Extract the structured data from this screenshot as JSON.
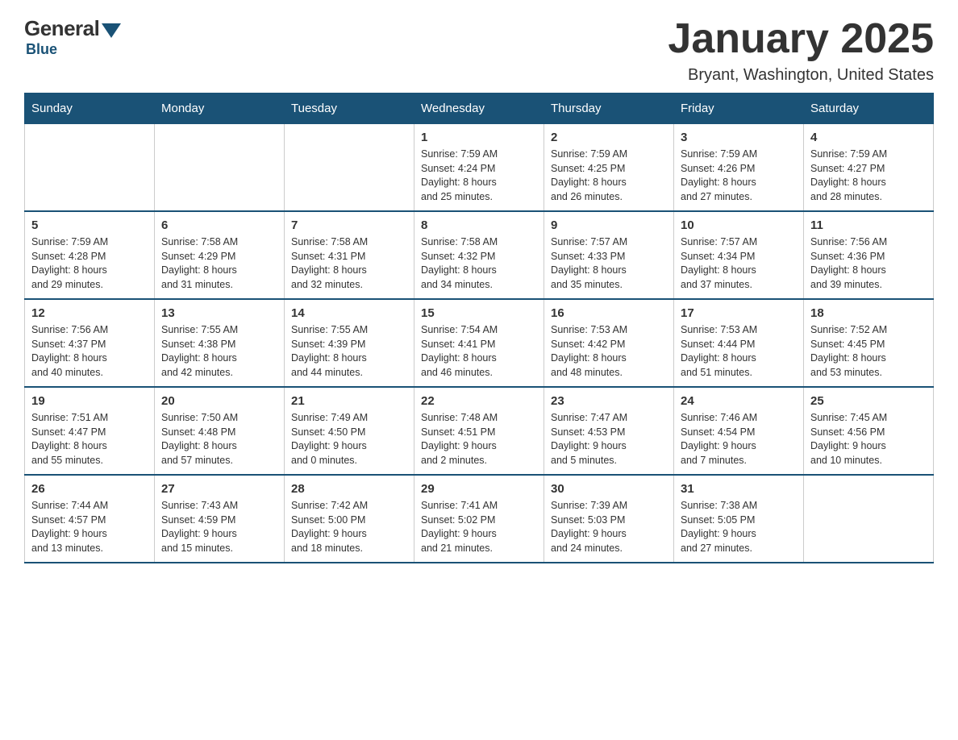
{
  "logo": {
    "general": "General",
    "blue": "Blue",
    "bottom": "Blue"
  },
  "title": "January 2025",
  "subtitle": "Bryant, Washington, United States",
  "days_of_week": [
    "Sunday",
    "Monday",
    "Tuesday",
    "Wednesday",
    "Thursday",
    "Friday",
    "Saturday"
  ],
  "weeks": [
    [
      {
        "day": "",
        "info": ""
      },
      {
        "day": "",
        "info": ""
      },
      {
        "day": "",
        "info": ""
      },
      {
        "day": "1",
        "info": "Sunrise: 7:59 AM\nSunset: 4:24 PM\nDaylight: 8 hours\nand 25 minutes."
      },
      {
        "day": "2",
        "info": "Sunrise: 7:59 AM\nSunset: 4:25 PM\nDaylight: 8 hours\nand 26 minutes."
      },
      {
        "day": "3",
        "info": "Sunrise: 7:59 AM\nSunset: 4:26 PM\nDaylight: 8 hours\nand 27 minutes."
      },
      {
        "day": "4",
        "info": "Sunrise: 7:59 AM\nSunset: 4:27 PM\nDaylight: 8 hours\nand 28 minutes."
      }
    ],
    [
      {
        "day": "5",
        "info": "Sunrise: 7:59 AM\nSunset: 4:28 PM\nDaylight: 8 hours\nand 29 minutes."
      },
      {
        "day": "6",
        "info": "Sunrise: 7:58 AM\nSunset: 4:29 PM\nDaylight: 8 hours\nand 31 minutes."
      },
      {
        "day": "7",
        "info": "Sunrise: 7:58 AM\nSunset: 4:31 PM\nDaylight: 8 hours\nand 32 minutes."
      },
      {
        "day": "8",
        "info": "Sunrise: 7:58 AM\nSunset: 4:32 PM\nDaylight: 8 hours\nand 34 minutes."
      },
      {
        "day": "9",
        "info": "Sunrise: 7:57 AM\nSunset: 4:33 PM\nDaylight: 8 hours\nand 35 minutes."
      },
      {
        "day": "10",
        "info": "Sunrise: 7:57 AM\nSunset: 4:34 PM\nDaylight: 8 hours\nand 37 minutes."
      },
      {
        "day": "11",
        "info": "Sunrise: 7:56 AM\nSunset: 4:36 PM\nDaylight: 8 hours\nand 39 minutes."
      }
    ],
    [
      {
        "day": "12",
        "info": "Sunrise: 7:56 AM\nSunset: 4:37 PM\nDaylight: 8 hours\nand 40 minutes."
      },
      {
        "day": "13",
        "info": "Sunrise: 7:55 AM\nSunset: 4:38 PM\nDaylight: 8 hours\nand 42 minutes."
      },
      {
        "day": "14",
        "info": "Sunrise: 7:55 AM\nSunset: 4:39 PM\nDaylight: 8 hours\nand 44 minutes."
      },
      {
        "day": "15",
        "info": "Sunrise: 7:54 AM\nSunset: 4:41 PM\nDaylight: 8 hours\nand 46 minutes."
      },
      {
        "day": "16",
        "info": "Sunrise: 7:53 AM\nSunset: 4:42 PM\nDaylight: 8 hours\nand 48 minutes."
      },
      {
        "day": "17",
        "info": "Sunrise: 7:53 AM\nSunset: 4:44 PM\nDaylight: 8 hours\nand 51 minutes."
      },
      {
        "day": "18",
        "info": "Sunrise: 7:52 AM\nSunset: 4:45 PM\nDaylight: 8 hours\nand 53 minutes."
      }
    ],
    [
      {
        "day": "19",
        "info": "Sunrise: 7:51 AM\nSunset: 4:47 PM\nDaylight: 8 hours\nand 55 minutes."
      },
      {
        "day": "20",
        "info": "Sunrise: 7:50 AM\nSunset: 4:48 PM\nDaylight: 8 hours\nand 57 minutes."
      },
      {
        "day": "21",
        "info": "Sunrise: 7:49 AM\nSunset: 4:50 PM\nDaylight: 9 hours\nand 0 minutes."
      },
      {
        "day": "22",
        "info": "Sunrise: 7:48 AM\nSunset: 4:51 PM\nDaylight: 9 hours\nand 2 minutes."
      },
      {
        "day": "23",
        "info": "Sunrise: 7:47 AM\nSunset: 4:53 PM\nDaylight: 9 hours\nand 5 minutes."
      },
      {
        "day": "24",
        "info": "Sunrise: 7:46 AM\nSunset: 4:54 PM\nDaylight: 9 hours\nand 7 minutes."
      },
      {
        "day": "25",
        "info": "Sunrise: 7:45 AM\nSunset: 4:56 PM\nDaylight: 9 hours\nand 10 minutes."
      }
    ],
    [
      {
        "day": "26",
        "info": "Sunrise: 7:44 AM\nSunset: 4:57 PM\nDaylight: 9 hours\nand 13 minutes."
      },
      {
        "day": "27",
        "info": "Sunrise: 7:43 AM\nSunset: 4:59 PM\nDaylight: 9 hours\nand 15 minutes."
      },
      {
        "day": "28",
        "info": "Sunrise: 7:42 AM\nSunset: 5:00 PM\nDaylight: 9 hours\nand 18 minutes."
      },
      {
        "day": "29",
        "info": "Sunrise: 7:41 AM\nSunset: 5:02 PM\nDaylight: 9 hours\nand 21 minutes."
      },
      {
        "day": "30",
        "info": "Sunrise: 7:39 AM\nSunset: 5:03 PM\nDaylight: 9 hours\nand 24 minutes."
      },
      {
        "day": "31",
        "info": "Sunrise: 7:38 AM\nSunset: 5:05 PM\nDaylight: 9 hours\nand 27 minutes."
      },
      {
        "day": "",
        "info": ""
      }
    ]
  ]
}
